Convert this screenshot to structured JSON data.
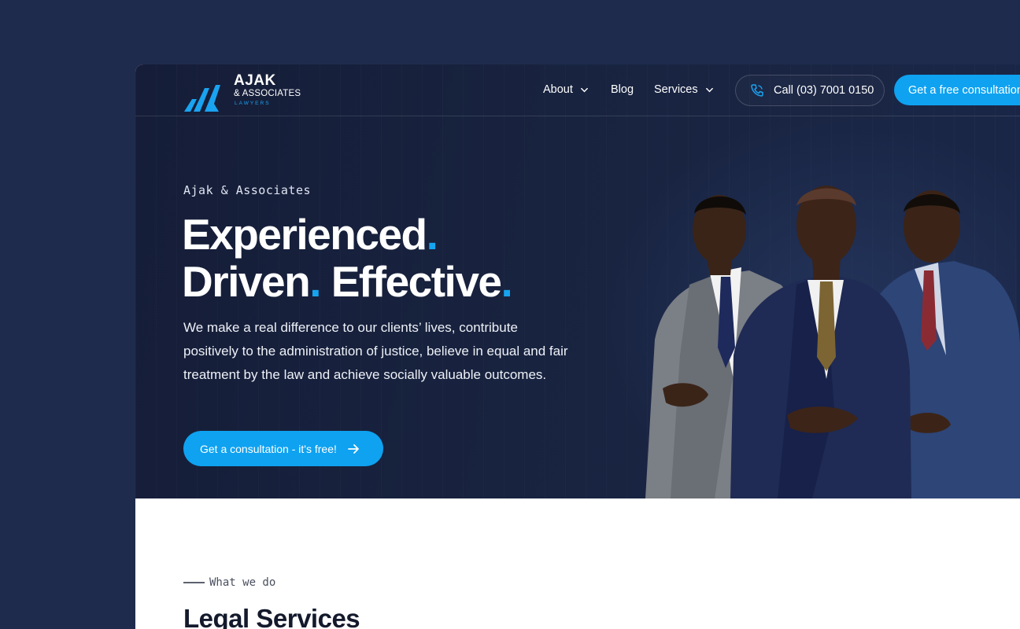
{
  "logo": {
    "name": "AJAK",
    "sub": "& ASSOCIATES",
    "tagline": "LAWYERS"
  },
  "nav": {
    "about": "About",
    "blog": "Blog",
    "services": "Services"
  },
  "header": {
    "call_label": "Call (03) 7001 0150",
    "cta_label": "Get a free consultation"
  },
  "hero": {
    "eyebrow": "Ajak & Associates",
    "headline": {
      "word1": "Experienced",
      "word2": "Driven",
      "word3": "Effective",
      "dot": "."
    },
    "intro": "We make a real difference to our clients’ lives, contribute positively to the administration of justice, believe in equal and fair treatment by the law and achieve socially valuable outcomes.",
    "cta_label": "Get a consultation - it's free!"
  },
  "section": {
    "eyebrow": "What we do",
    "title": "Legal Services"
  },
  "colors": {
    "accent": "#0ea2f1",
    "hero_bg": "#18233f",
    "page_bg": "#1f2b4d"
  },
  "icons": [
    "logo-mark-icon",
    "chevron-down-icon",
    "phone-icon",
    "arrow-right-icon"
  ]
}
